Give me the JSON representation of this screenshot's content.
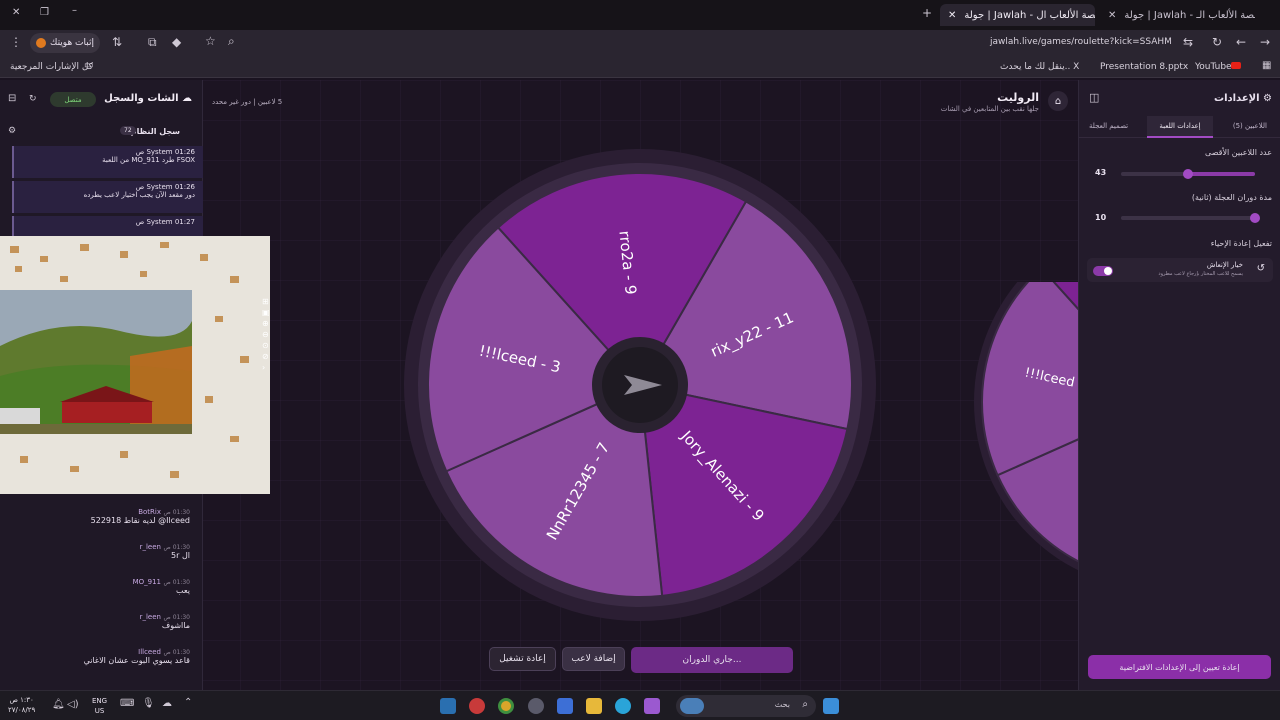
{
  "browser": {
    "tabs": [
      {
        "title": "جولة | Jawlah - منصة الألعاب ال"
      },
      {
        "title": "جولة | Jawlah - منصة الألعاب الـ"
      }
    ],
    "address": "jawlah.live/games/roulette?kick=SSAHM",
    "profile_button": "إثبات هويتك",
    "bookmarks": [
      {
        "label": "YouTube"
      },
      {
        "label": "Presentation 8.pptx"
      },
      {
        "label": "ينقل لك ما يحدث.. X"
      }
    ],
    "all_bookmarks": "كل الإشارات المرجعية"
  },
  "chat": {
    "title": "الشات والسجل",
    "status": "متصل",
    "log_title": "سجل النظام",
    "log_count": "72",
    "system_messages": [
      {
        "who": "System",
        "time": "01:26 ص",
        "text": "FSOX طرد MO_911 من اللعبة"
      },
      {
        "who": "System",
        "time": "01:26 ص",
        "text": "دور مقعد الآن يجب اختيار لاعب يطرده"
      },
      {
        "who": "System",
        "time": "01:27 ص",
        "text": ""
      }
    ],
    "messages": [
      {
        "who": "BotRix",
        "time": "01:30 ص",
        "text": "Ilceed@ لديه نقاط 522918"
      },
      {
        "who": "r_leen",
        "time": "01:30 ص",
        "text": "ال 5r"
      },
      {
        "who": "MO_911",
        "time": "01:30 ص",
        "text": "يعب"
      },
      {
        "who": "r_leen",
        "time": "01:30 ص",
        "text": "مااشوف"
      },
      {
        "who": "Illceed",
        "time": "01:30 ص",
        "text": "قاعد يسوي البوت عشان الاغاني"
      }
    ]
  },
  "header": {
    "title": "الروليت",
    "subtitle": "جلها نقب بين المتابعين في الشات",
    "players": "5 لاعبين",
    "mode": "دور غير محدد"
  },
  "wheel": {
    "segments": [
      {
        "label": "rix_y22 - 11",
        "color": "#8a4a9e"
      },
      {
        "label": "Jory_Alenazi - 9",
        "color": "#7d2393"
      },
      {
        "label": "NnRr12345 - 7",
        "color": "#8a4a9e"
      },
      {
        "label": "!!!lceed - 3",
        "color": "#8a4a9e"
      },
      {
        "label": "rro2a - 9",
        "color": "#7d2393"
      }
    ]
  },
  "buttons": {
    "spinning": "جاري الدوران...",
    "add_player": "إضافة لاعب",
    "restart": "إعادة تشغيل"
  },
  "settings": {
    "title": "الإعدادات",
    "tabs": [
      "اللاعبين (5)",
      "إعدادات اللعبة",
      "تصميم العجلة"
    ],
    "max_players_label": "عدد اللاعبين الأقصى",
    "max_players_value": "43",
    "max_players_fraction": 0.5,
    "spin_duration_label": "مدة دوران العجلة (ثانية)",
    "spin_duration_value": "10",
    "spin_duration_fraction": 0.0,
    "revive_label": "تفعيل إعادة الإحياء",
    "revive_option_title": "خيار الإنعاش",
    "revive_option_desc": "يسمح للاعب المختار بإرجاع لاعب مطرود",
    "reset_button": "إعادة تعيين إلى الإعدادات الافتراضية"
  },
  "taskbar": {
    "search": "بحث",
    "lang": "ENG",
    "region": "US",
    "time": "١:٣٠ ص",
    "date": "٢٧/٠٨/٢٩"
  }
}
